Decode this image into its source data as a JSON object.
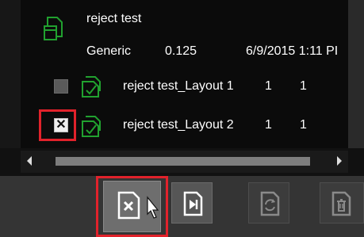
{
  "group": {
    "name": "reject test",
    "type": "Generic",
    "value": "0.125",
    "date": "6/9/2015 1:11 PI"
  },
  "items": [
    {
      "name": "reject test_Layout 1",
      "col1": "1",
      "col2": "1",
      "checked": false
    },
    {
      "name": "reject test_Layout 2",
      "col1": "1",
      "col2": "1",
      "checked": true
    }
  ],
  "checkbox_check_glyph": "✕",
  "colors": {
    "icon_green": "#21a12f",
    "highlight_red": "#e1222b"
  },
  "toolbar": {
    "buttons": [
      {
        "icon": "reject-file-icon",
        "state": "pressed"
      },
      {
        "icon": "skip-to-end-file-icon",
        "state": "enabled"
      },
      {
        "icon": "refresh-file-icon",
        "state": "disabled"
      },
      {
        "icon": "delete-file-icon",
        "state": "disabled"
      }
    ]
  }
}
